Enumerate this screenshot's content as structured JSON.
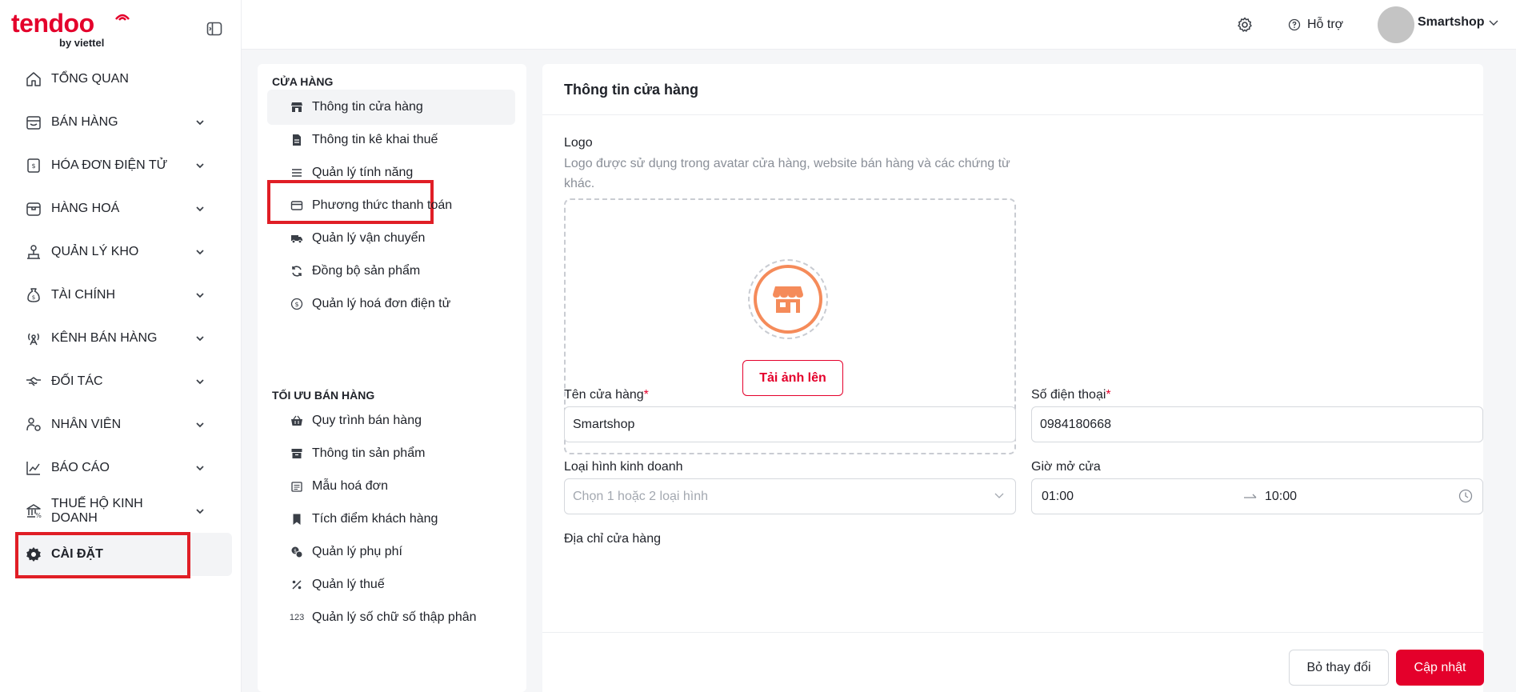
{
  "brand": {
    "name": "tendoo",
    "sub": "by viettel",
    "accent": "#e4002b"
  },
  "header": {
    "help_label": "Hỗ trợ",
    "user_name": "Smartshop"
  },
  "sidebar": {
    "items": [
      {
        "label": "TỔNG QUAN",
        "icon": "home-icon",
        "has_children": false
      },
      {
        "label": "BÁN HÀNG",
        "icon": "shop-icon",
        "has_children": true
      },
      {
        "label": "HÓA ĐƠN ĐIỆN TỬ",
        "icon": "invoice-icon",
        "has_children": true
      },
      {
        "label": "HÀNG HOÁ",
        "icon": "box-icon",
        "has_children": true
      },
      {
        "label": "QUẢN LÝ KHO",
        "icon": "warehouse-icon",
        "has_children": true
      },
      {
        "label": "TÀI CHÍNH",
        "icon": "money-bag-icon",
        "has_children": true
      },
      {
        "label": "KÊNH BÁN HÀNG",
        "icon": "antenna-icon",
        "has_children": true
      },
      {
        "label": "ĐỐI TÁC",
        "icon": "handshake-icon",
        "has_children": true
      },
      {
        "label": "NHÂN VIÊN",
        "icon": "staff-icon",
        "has_children": true
      },
      {
        "label": "BÁO CÁO",
        "icon": "chart-icon",
        "has_children": true
      },
      {
        "label": "THUẾ HỘ KINH DOANH",
        "icon": "bank-icon",
        "has_children": true
      },
      {
        "label": "CÀI ĐẶT",
        "icon": "gear-icon",
        "has_children": false,
        "active": true
      }
    ]
  },
  "settings_menu": {
    "groups": [
      {
        "title": "CỬA HÀNG",
        "items": [
          {
            "label": "Thông tin cửa hàng",
            "icon": "store-icon",
            "active": true
          },
          {
            "label": "Thông tin kê khai thuế",
            "icon": "document-icon"
          },
          {
            "label": "Quản lý tính năng",
            "icon": "list-icon"
          },
          {
            "label": "Phương thức thanh toán",
            "icon": "card-icon"
          },
          {
            "label": "Quản lý vận chuyển",
            "icon": "truck-icon"
          },
          {
            "label": "Đồng bộ sản phẩm",
            "icon": "sync-icon"
          },
          {
            "label": "Quản lý hoá đơn điện tử",
            "icon": "dollar-circle-icon"
          }
        ]
      },
      {
        "title": "TỐI ƯU BÁN HÀNG",
        "items": [
          {
            "label": "Quy trình bán hàng",
            "icon": "basket-icon"
          },
          {
            "label": "Thông tin sản phẩm",
            "icon": "archive-icon"
          },
          {
            "label": "Mẫu hoá đơn",
            "icon": "receipt-icon"
          },
          {
            "label": "Tích điểm khách hàng",
            "icon": "bookmark-icon"
          },
          {
            "label": "Quản lý phụ phí",
            "icon": "coins-icon"
          },
          {
            "label": "Quản lý thuế",
            "icon": "percent-icon"
          },
          {
            "label": "Quản lý số chữ số thập phân",
            "icon": "decimal-icon",
            "icon_text": "123"
          }
        ]
      }
    ]
  },
  "content": {
    "title": "Thông tin cửa hàng",
    "logo_label": "Logo",
    "logo_hint": "Logo được sử dụng trong avatar cửa hàng, website bán hàng và các chứng từ khác.",
    "upload_label": "Tải ảnh lên",
    "store_name": {
      "label": "Tên cửa hàng",
      "value": "Smartshop"
    },
    "phone": {
      "label": "Số điện thoại",
      "value": "0984180668"
    },
    "business_type": {
      "label": "Loại hình kinh doanh",
      "placeholder": "Chọn 1 hoặc 2 loại hình"
    },
    "opening_hours": {
      "label": "Giờ mở cửa",
      "from": "01:00",
      "to": "10:00"
    },
    "address": {
      "label": "Địa chỉ cửa hàng"
    },
    "required_mark": "*"
  },
  "footer": {
    "cancel_label": "Bỏ thay đổi",
    "save_label": "Cập nhật"
  },
  "colors": {
    "accent": "#e4002b",
    "highlight_box": "#e01e26",
    "logo_orange": "#f58b5a"
  }
}
